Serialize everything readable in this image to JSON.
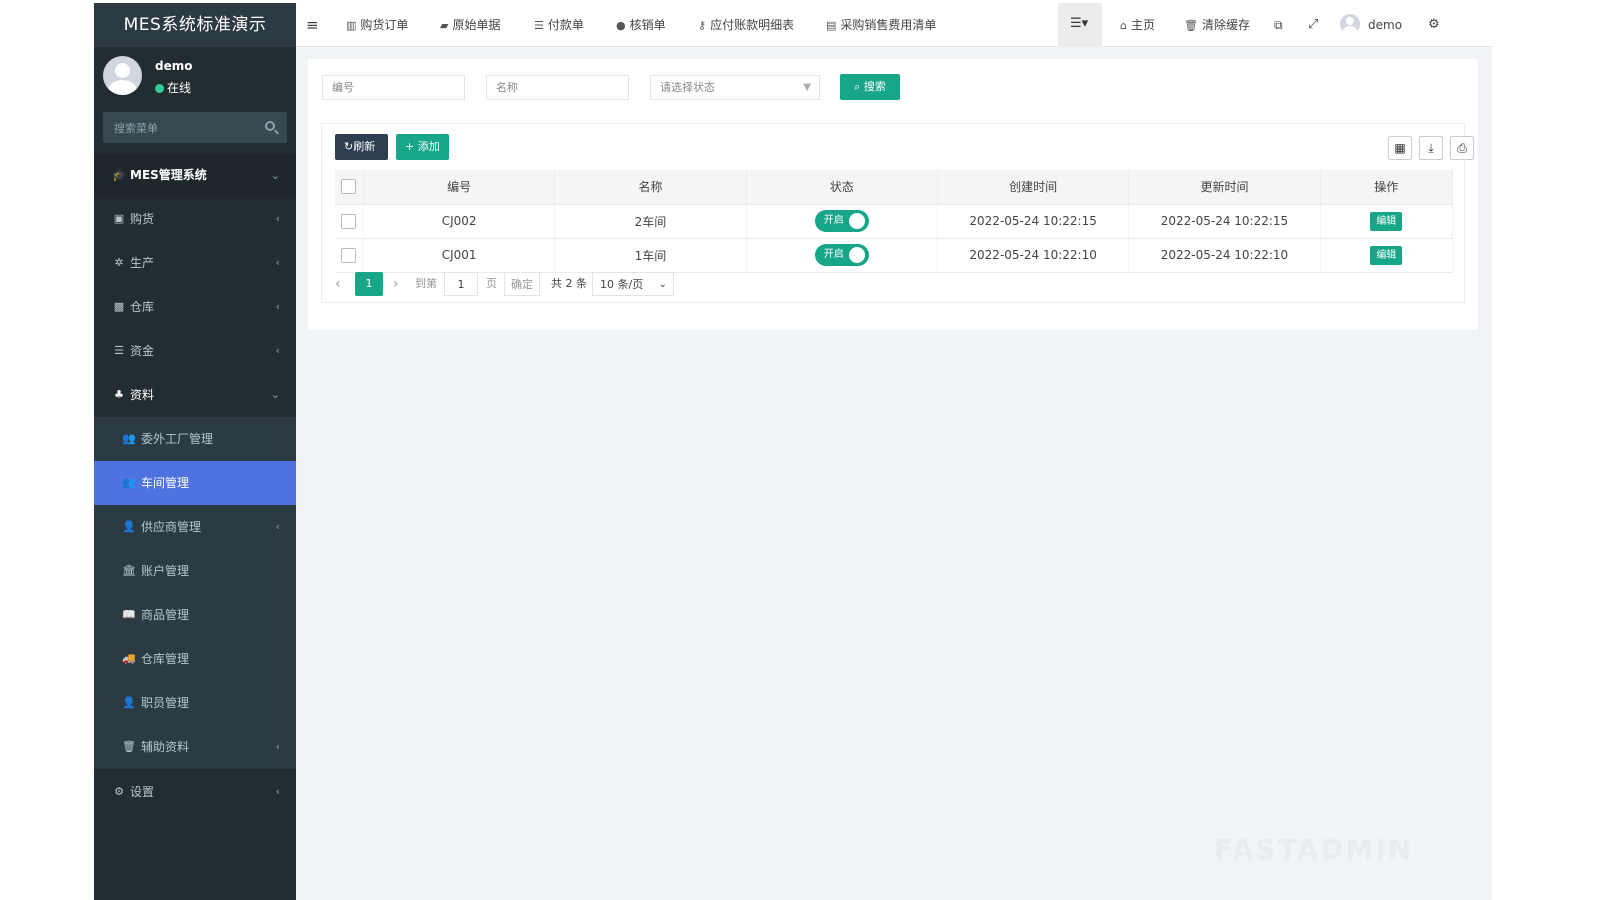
{
  "app": {
    "logo": "MES系统标准演示",
    "watermark": "FASTADMIN"
  },
  "user": {
    "name": "demo",
    "status": "在线"
  },
  "sidebar": {
    "search_placeholder": "搜索菜单",
    "header": "MES管理系统",
    "items": [
      {
        "label": "购货",
        "icon": "cart-icon"
      },
      {
        "label": "生产",
        "icon": "gear-icon"
      },
      {
        "label": "仓库",
        "icon": "warehouse-icon"
      },
      {
        "label": "资金",
        "icon": "database-icon"
      },
      {
        "label": "资料",
        "icon": "users-icon"
      }
    ],
    "submenu": [
      {
        "label": "委外工厂管理",
        "icon": "user-plus-icon"
      },
      {
        "label": "车间管理",
        "icon": "user-plus-icon"
      },
      {
        "label": "供应商管理",
        "icon": "user-icon"
      },
      {
        "label": "账户管理",
        "icon": "bank-icon"
      },
      {
        "label": "商品管理",
        "icon": "book-icon"
      },
      {
        "label": "仓库管理",
        "icon": "truck-icon"
      },
      {
        "label": "职员管理",
        "icon": "user-icon"
      },
      {
        "label": "辅助资料",
        "icon": "trash-icon"
      }
    ],
    "settings": "设置"
  },
  "navbar": {
    "tabs": [
      {
        "label": "购货订单",
        "icon": "bar-chart-icon"
      },
      {
        "label": "原始单据",
        "icon": "book-icon"
      },
      {
        "label": "付款单",
        "icon": "database-icon"
      },
      {
        "label": "核销单",
        "icon": "apple-icon"
      },
      {
        "label": "应付账款明细表",
        "icon": "key-icon"
      },
      {
        "label": "采购销售费用清单",
        "icon": "list-alt-icon"
      }
    ],
    "home": "主页",
    "clear_cache": "清除缓存",
    "user": "demo"
  },
  "filters": {
    "code_placeholder": "编号",
    "name_placeholder": "名称",
    "status_placeholder": "请选择状态",
    "search_label": "搜索"
  },
  "toolbar": {
    "refresh": "刷新",
    "add": "添加"
  },
  "table": {
    "columns": [
      "编号",
      "名称",
      "状态",
      "创建时间",
      "更新时间",
      "操作"
    ],
    "rows": [
      {
        "code": "CJ002",
        "name": "2车间",
        "status": "开启",
        "created": "2022-05-24 10:22:15",
        "updated": "2022-05-24 10:22:15",
        "action": "编辑"
      },
      {
        "code": "CJ001",
        "name": "1车间",
        "status": "开启",
        "created": "2022-05-24 10:22:10",
        "updated": "2022-05-24 10:22:10",
        "action": "编辑"
      }
    ]
  },
  "pagination": {
    "prev": "‹",
    "current": "1",
    "next": "›",
    "goto": "到第",
    "page_input": "1",
    "page_unit": "页",
    "confirm": "确定",
    "total": "共 2 条",
    "per_page": "10 条/页"
  }
}
